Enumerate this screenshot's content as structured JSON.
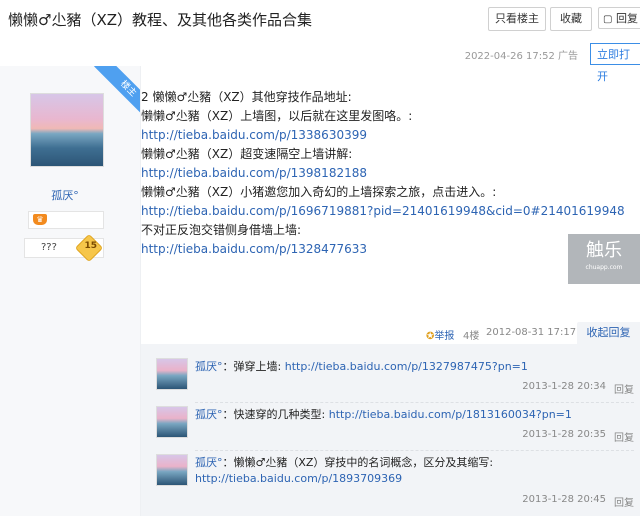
{
  "header": {
    "title": "懒懒♂尐豬（XZ）教程、及其他各类作品合集",
    "only_op_label": "只看楼主",
    "favorite_label": "收藏",
    "reply_label": "回复"
  },
  "meta": {
    "timestamp": "2022-04-26 17:52 广告",
    "open_now_label": "立即打开"
  },
  "author": {
    "name": "孤厌°",
    "badge_unknown": "???",
    "level": "15",
    "op_ribbon": "楼主"
  },
  "post": {
    "lines": [
      {
        "text": "2 懒懒♂尐豬（XZ）其他穿技作品地址:",
        "link": false
      },
      {
        "text": "懒懒♂尐豬（XZ）上墙图，以后就在这里发图咯。:",
        "link": false
      },
      {
        "text": "http://tieba.baidu.com/p/1338630399",
        "link": true
      },
      {
        "text": "懒懒♂尐豬（XZ）超变速隔空上墙讲解:",
        "link": false
      },
      {
        "text": "http://tieba.baidu.com/p/1398182188",
        "link": true
      },
      {
        "text": "懒懒♂尐豬（XZ）小猪邀您加入奇幻的上墙探索之旅，点击进入。:",
        "link": false
      },
      {
        "text": "http://tieba.baidu.com/p/1696719881?pid=21401619948&cid=0#21401619948",
        "link": true
      },
      {
        "text": "不对正反泡交错侧身借墙上墙:",
        "link": false
      },
      {
        "text": "http://tieba.baidu.com/p/1328477633",
        "link": true
      }
    ],
    "report_label": "举报",
    "floor": "4楼",
    "time": "2012-08-31 17:17",
    "collapse_label": "收起回复"
  },
  "watermark": {
    "text_cn": "触乐",
    "text_en": "chuapp.com"
  },
  "replies": [
    {
      "name": "孤厌°",
      "text": "弹穿上墙:",
      "link": "http://tieba.baidu.com/p/1327987475?pn=1",
      "link2": "",
      "time": "2013-1-28 20:34",
      "reply_label": "回复"
    },
    {
      "name": "孤厌°",
      "text": "快速穿的几种类型:",
      "link": "http://tieba.baidu.com/p/1813160034?pn=1",
      "link2": "",
      "time": "2013-1-28 20:35",
      "reply_label": "回复"
    },
    {
      "name": "孤厌°",
      "text": "懒懒♂尐豬（XZ）穿技中的名词概念，区分及其缩写:",
      "link": "",
      "link2": "http://tieba.baidu.com/p/1893709369",
      "time": "2013-1-28 20:45",
      "reply_label": "回复"
    }
  ]
}
